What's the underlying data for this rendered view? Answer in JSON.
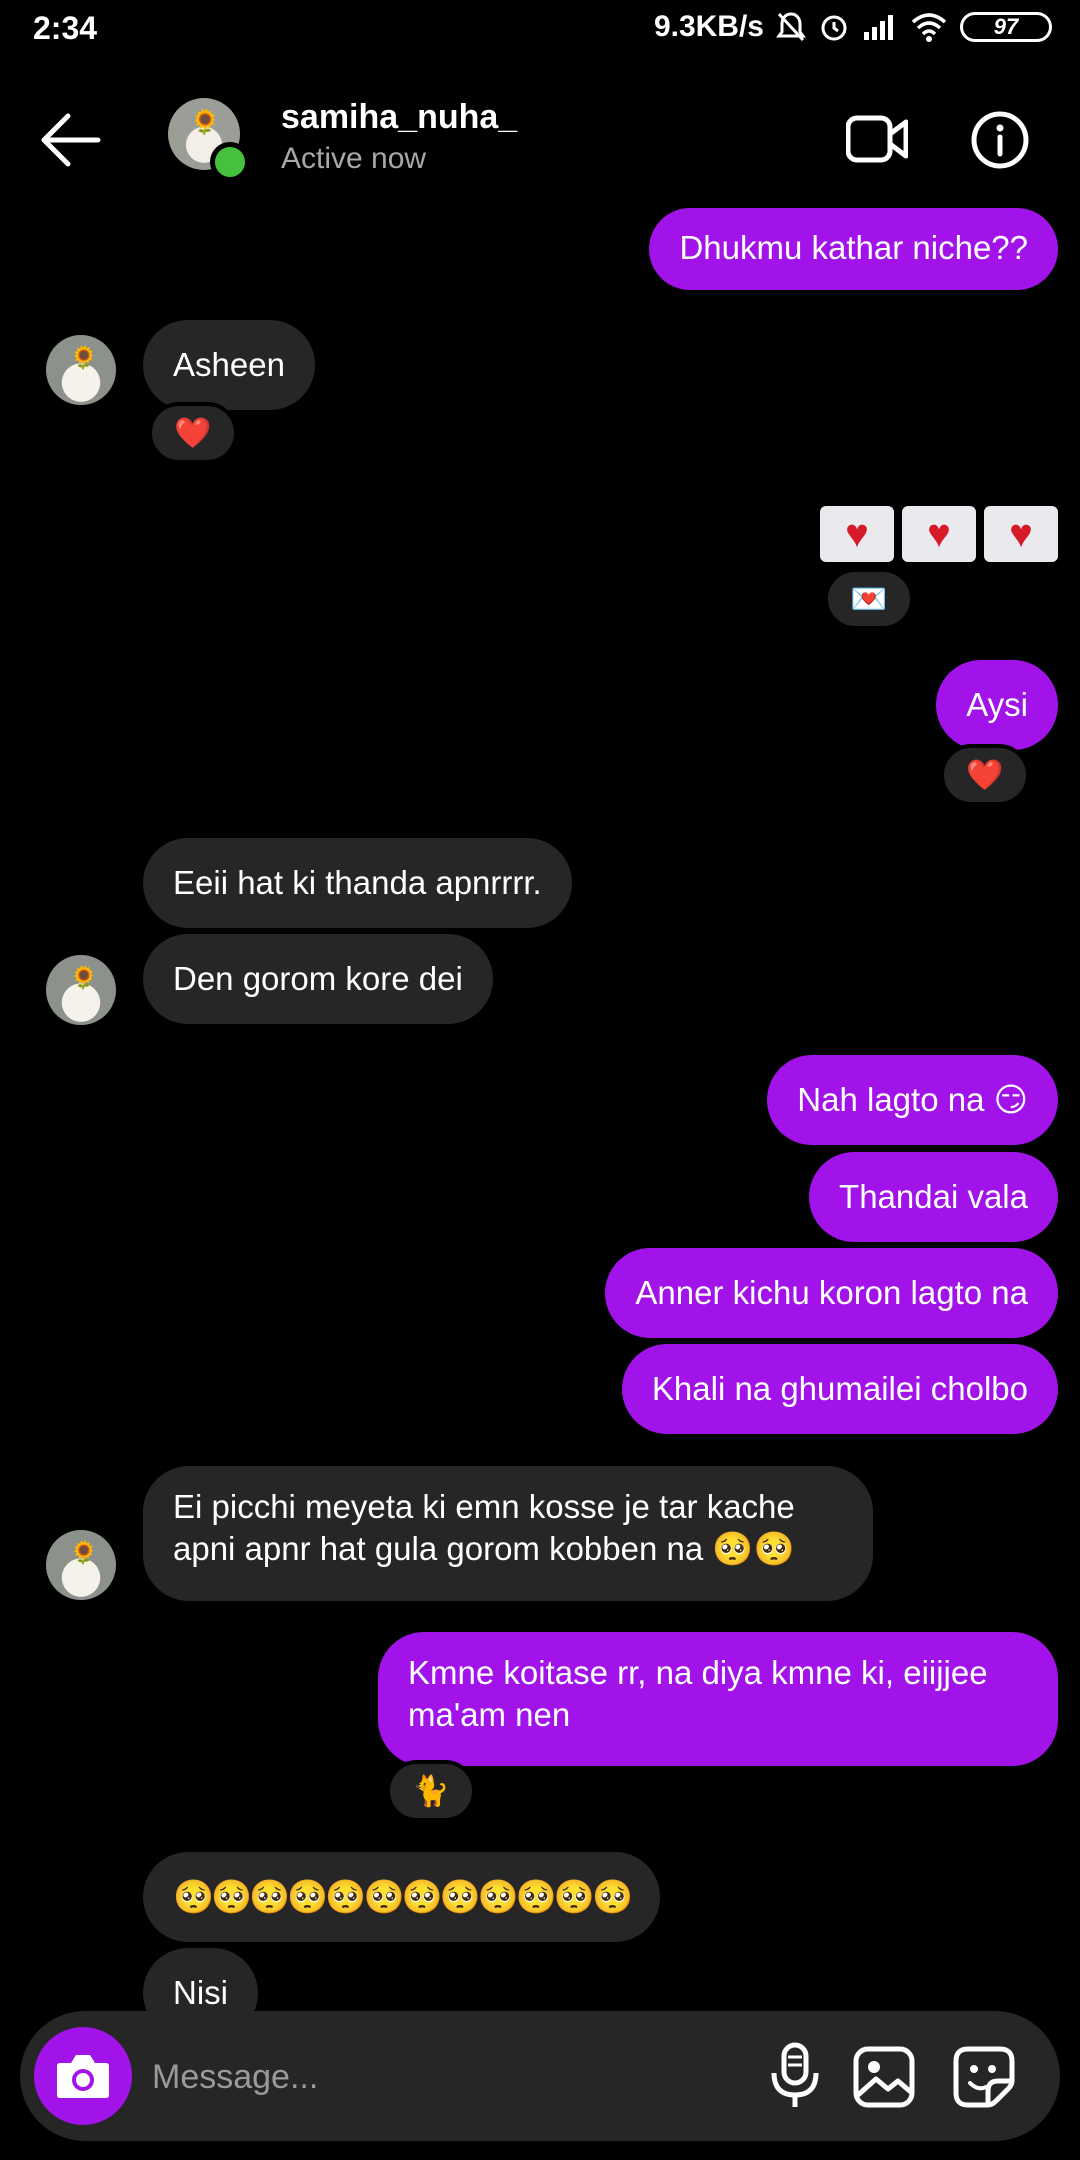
{
  "status_bar": {
    "time": "2:34",
    "network_speed": "9.3KB/s",
    "battery": "97",
    "icons": [
      "bell-off-icon",
      "alarm-icon",
      "signal-icon",
      "wifi-icon",
      "battery-icon"
    ]
  },
  "header": {
    "username": "samiha_nuha_",
    "status": "Active now",
    "icons": [
      "back-arrow-icon",
      "video-call-icon",
      "info-icon"
    ]
  },
  "messages": [
    {
      "id": "m1",
      "side": "out",
      "text": "Dhukmu kathar niche??"
    },
    {
      "id": "m2",
      "side": "in",
      "text": "Asheen",
      "reaction": "❤️"
    },
    {
      "id": "m3",
      "side": "out",
      "type": "emoji-envelopes",
      "reaction": "💌"
    },
    {
      "id": "m4",
      "side": "out",
      "text": "Aysi",
      "reaction": "❤️"
    },
    {
      "id": "m5",
      "side": "in",
      "text": "Eeii hat ki thanda apnrrrr."
    },
    {
      "id": "m6",
      "side": "in",
      "text": "Den gorom kore dei"
    },
    {
      "id": "m7",
      "side": "out",
      "text": "Nah lagto na 😏"
    },
    {
      "id": "m8",
      "side": "out",
      "text": "Thandai vala"
    },
    {
      "id": "m9",
      "side": "out",
      "text": "Anner kichu koron lagto na"
    },
    {
      "id": "m10",
      "side": "out",
      "text": "Khali na ghumailei cholbo"
    },
    {
      "id": "m11",
      "side": "in",
      "line1": "Ei picchi meyeta ki emn kosse je tar kache",
      "line2": "apni apnr hat gula gorom kobben na 🥺🥺"
    },
    {
      "id": "m12",
      "side": "out",
      "line1": "Kmne koitase rr, na diya kmne ki, eiijjee",
      "line2": "ma'am nen",
      "reaction": "🐈"
    },
    {
      "id": "m13",
      "side": "in",
      "text": "🥺🥺🥺🥺🥺🥺🥺🥺🥺🥺🥺🥺"
    },
    {
      "id": "m14",
      "side": "in",
      "text": "Nisi"
    }
  ],
  "composer": {
    "placeholder": "Message...",
    "icons": [
      "camera-icon",
      "microphone-icon",
      "gallery-icon",
      "sticker-icon"
    ]
  },
  "colors": {
    "background": "#000000",
    "outgoing_bubble": "#a113e8",
    "incoming_bubble": "#262626",
    "online": "#44c23d"
  }
}
